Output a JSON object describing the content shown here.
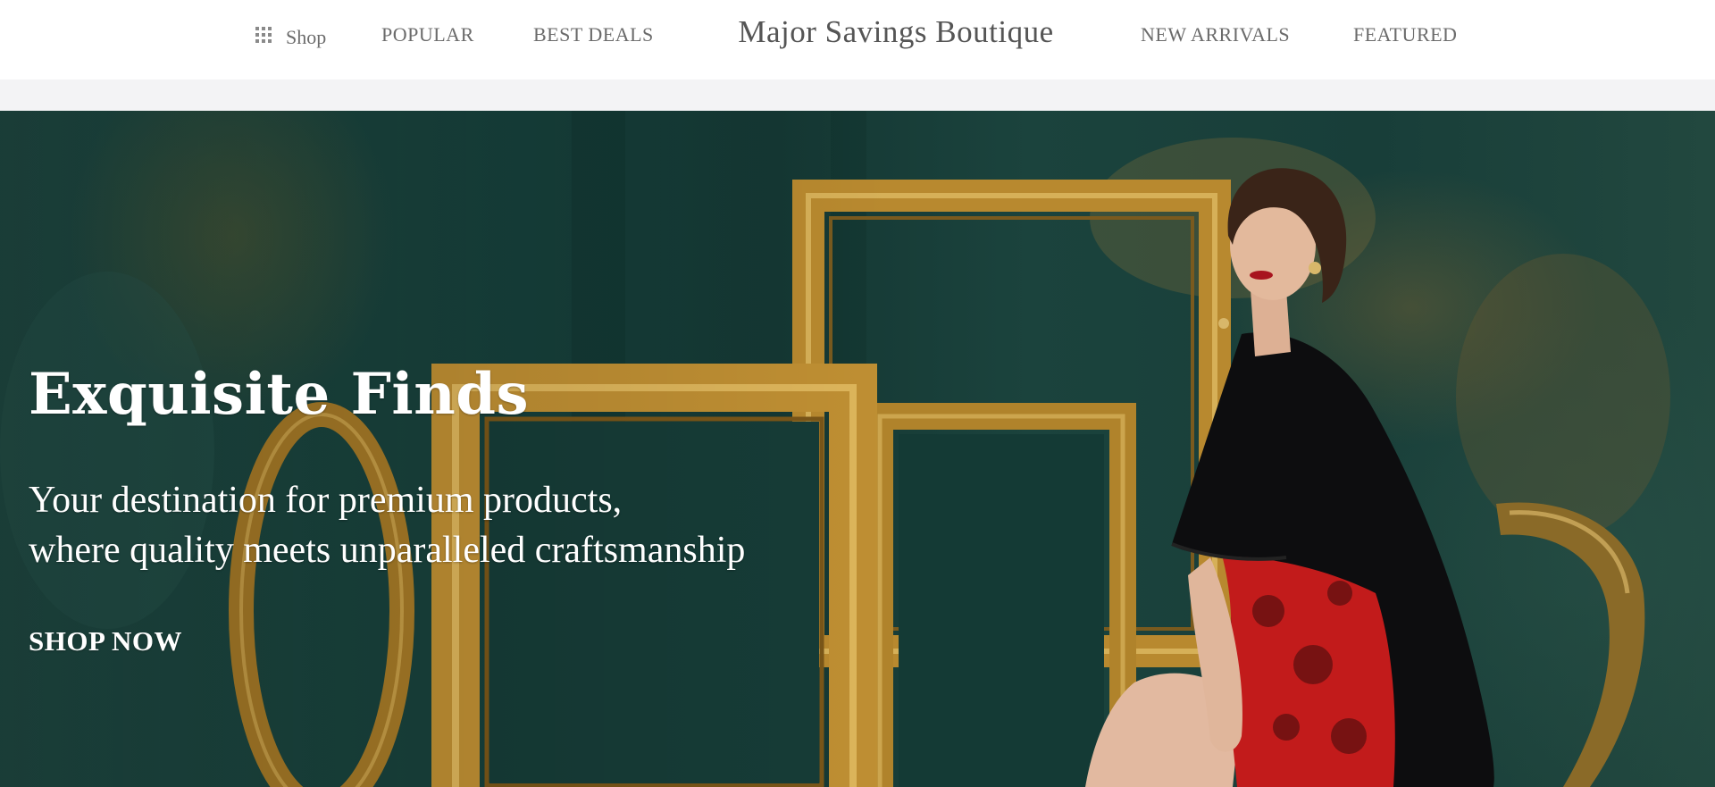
{
  "header": {
    "shop_label": "Shop",
    "brand": "Major Savings Boutique",
    "nav_left": [
      "POPULAR",
      "BEST DEALS"
    ],
    "nav_right": [
      "NEW ARRIVALS",
      "FEATURED"
    ],
    "icons": {
      "shop_menu": "grid-icon"
    }
  },
  "hero": {
    "title": "Exquisite Finds",
    "subtitle_line1": "Your destination for premium products,",
    "subtitle_line2": "where quality meets unparalleled craftsmanship",
    "cta_label": "SHOP NOW",
    "image_subject": "woman in black cape and red dress seated beside ornate gold picture frames against a dark teal painted wall"
  },
  "colors": {
    "header_bg": "#ffffff",
    "subbar_bg": "#f3f3f5",
    "nav_text": "#6b6b6b",
    "hero_wall": "#163f3a",
    "frame_gold": "#b8892f",
    "hero_text": "#ffffff"
  }
}
